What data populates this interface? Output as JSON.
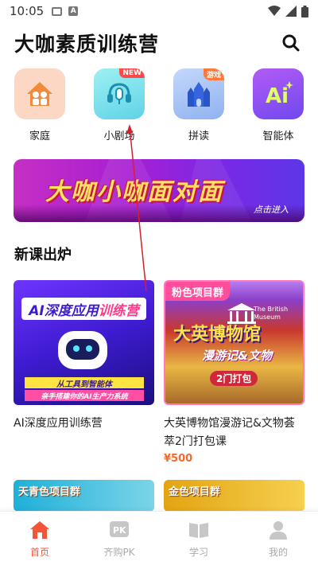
{
  "status_bar": {
    "time": "10:05"
  },
  "header": {
    "title": "大咖素质训练营"
  },
  "categories": [
    {
      "label": "家庭",
      "icon": "family-house-icon",
      "color": "#fbd3bf"
    },
    {
      "label": "小剧场",
      "icon": "headset-mic-icon",
      "badge": "NEW",
      "color": "#7de0ea"
    },
    {
      "label": "拼读",
      "icon": "castle-icon",
      "badge": "游戏",
      "color": "#a9c6f7"
    },
    {
      "label": "智能体",
      "icon": "ai-icon",
      "color": "#8c5cf2"
    }
  ],
  "banner": {
    "title": "大咖小咖面对面",
    "cta": "点击进入"
  },
  "section": {
    "title": "新课出炉"
  },
  "courses": [
    {
      "title": "AI深度应用训练营",
      "thumb": {
        "heading_main": "AI深度应用",
        "heading_highlight": "训练营",
        "strip1": "从工具到智能体",
        "strip2": "亲手搭建你的AI生产力系统"
      }
    },
    {
      "title": "大英博物馆漫游记&文物荟萃2门打包课",
      "price": "¥500",
      "thumb": {
        "tag": "粉色项目群",
        "heading": "大英博物馆",
        "sub": "漫游记&文物",
        "pack": "2门打包",
        "en": "The British Museum"
      }
    },
    {
      "thumb": {
        "tag": "天青色项目群"
      }
    },
    {
      "thumb": {
        "tag": "金色项目群"
      }
    }
  ],
  "bottom_nav": [
    {
      "label": "首页",
      "icon": "home-icon",
      "active": true
    },
    {
      "label": "齐购PK",
      "icon": "pk-icon",
      "active": false
    },
    {
      "label": "学习",
      "icon": "book-icon",
      "active": false
    },
    {
      "label": "我的",
      "icon": "user-icon",
      "active": false
    }
  ],
  "colors": {
    "accent": "#f2553a",
    "price": "#f26a2c",
    "annotation_arrow": "#d81e2c"
  }
}
